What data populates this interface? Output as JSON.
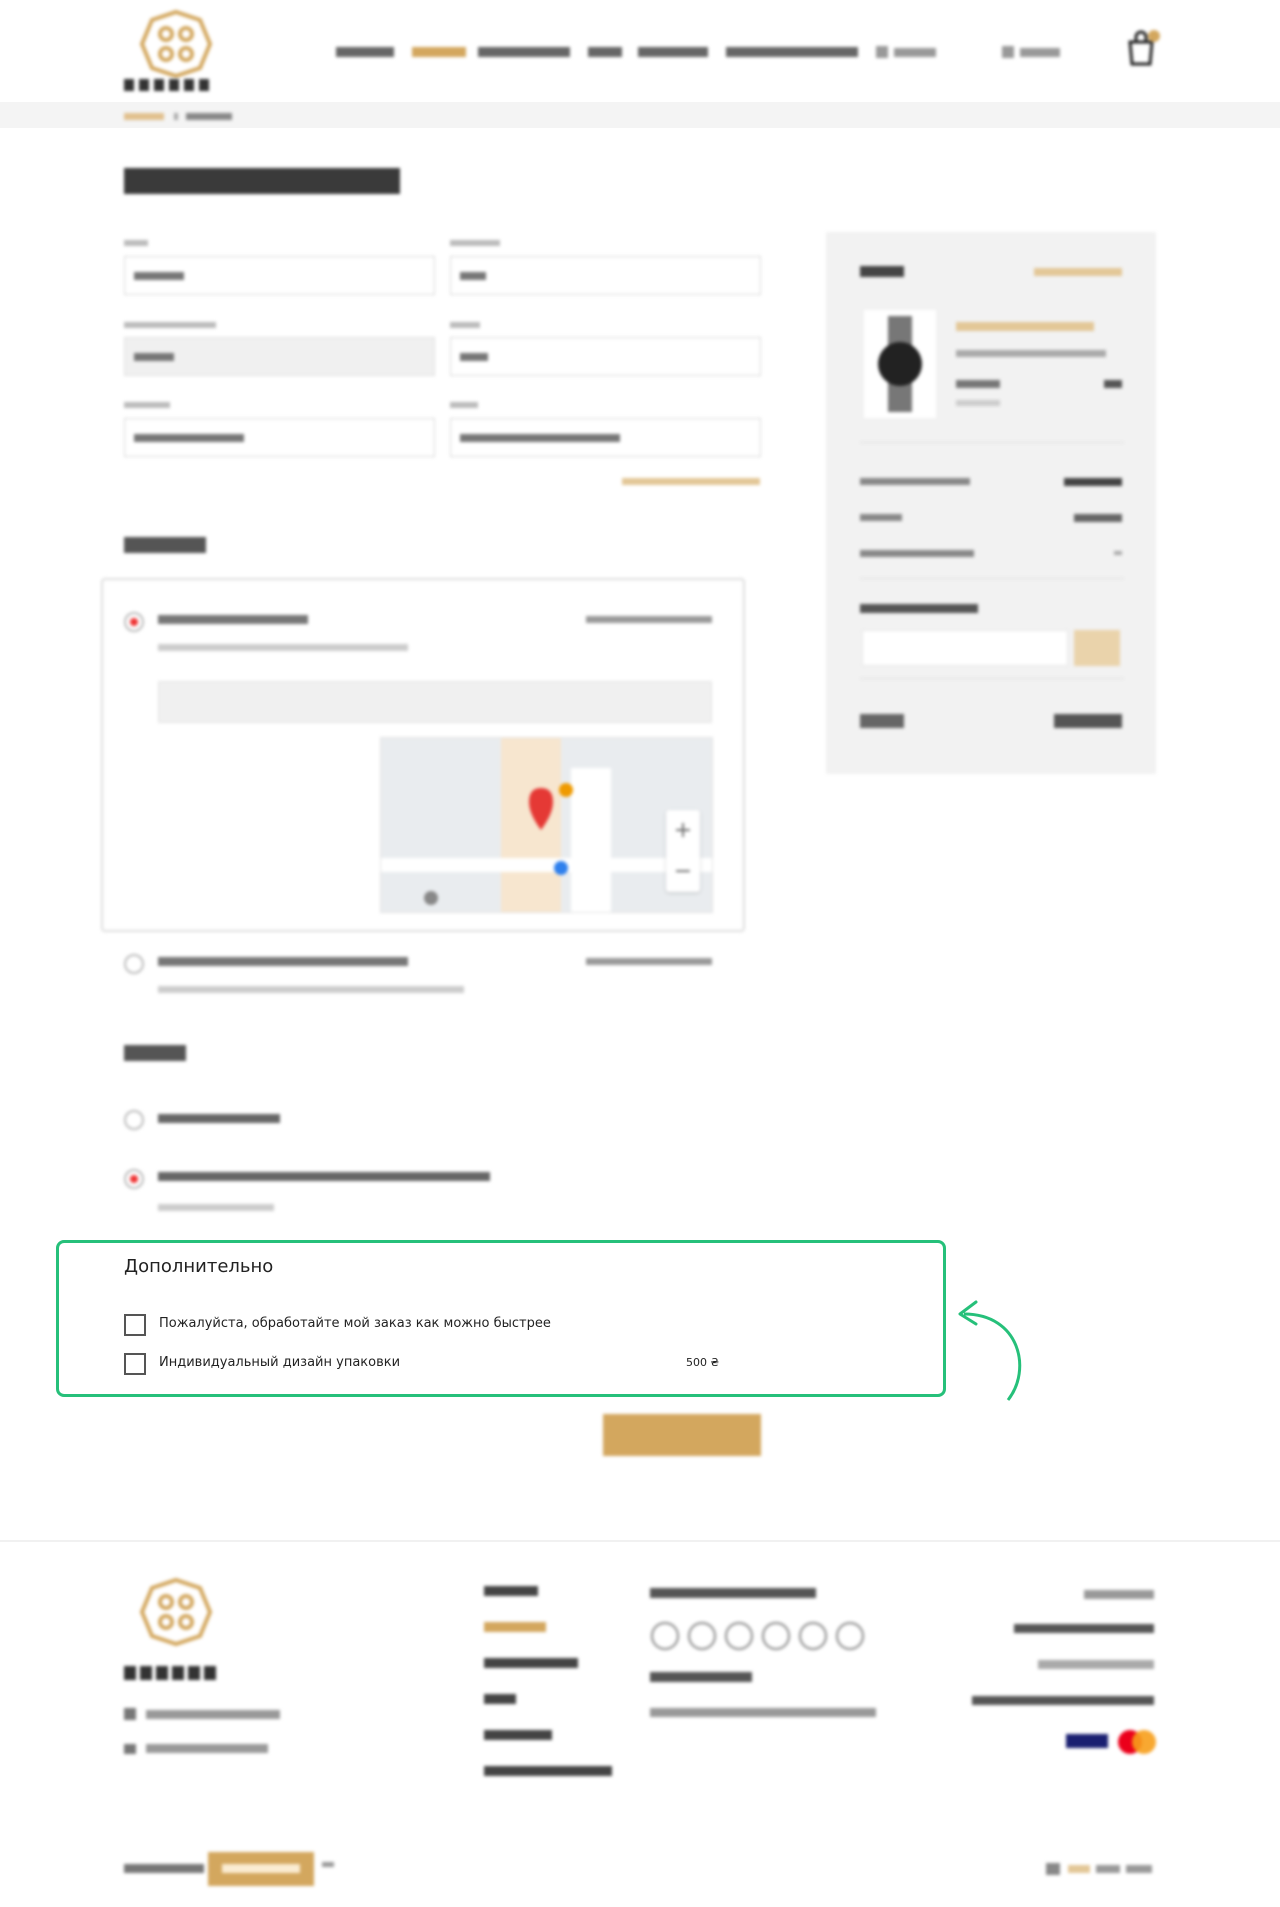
{
  "additional": {
    "title": "Дополнительно",
    "options": [
      {
        "label": "Пожалуйста, обработайте мой заказ как можно быстрее",
        "checked": false
      },
      {
        "label": "Индивидуальный дизайн упаковки",
        "checked": false,
        "price": "500 ₴"
      }
    ]
  },
  "colors": {
    "accent": "#d3a75e",
    "highlight": "#26c07a",
    "radio_on": "#e33333"
  }
}
